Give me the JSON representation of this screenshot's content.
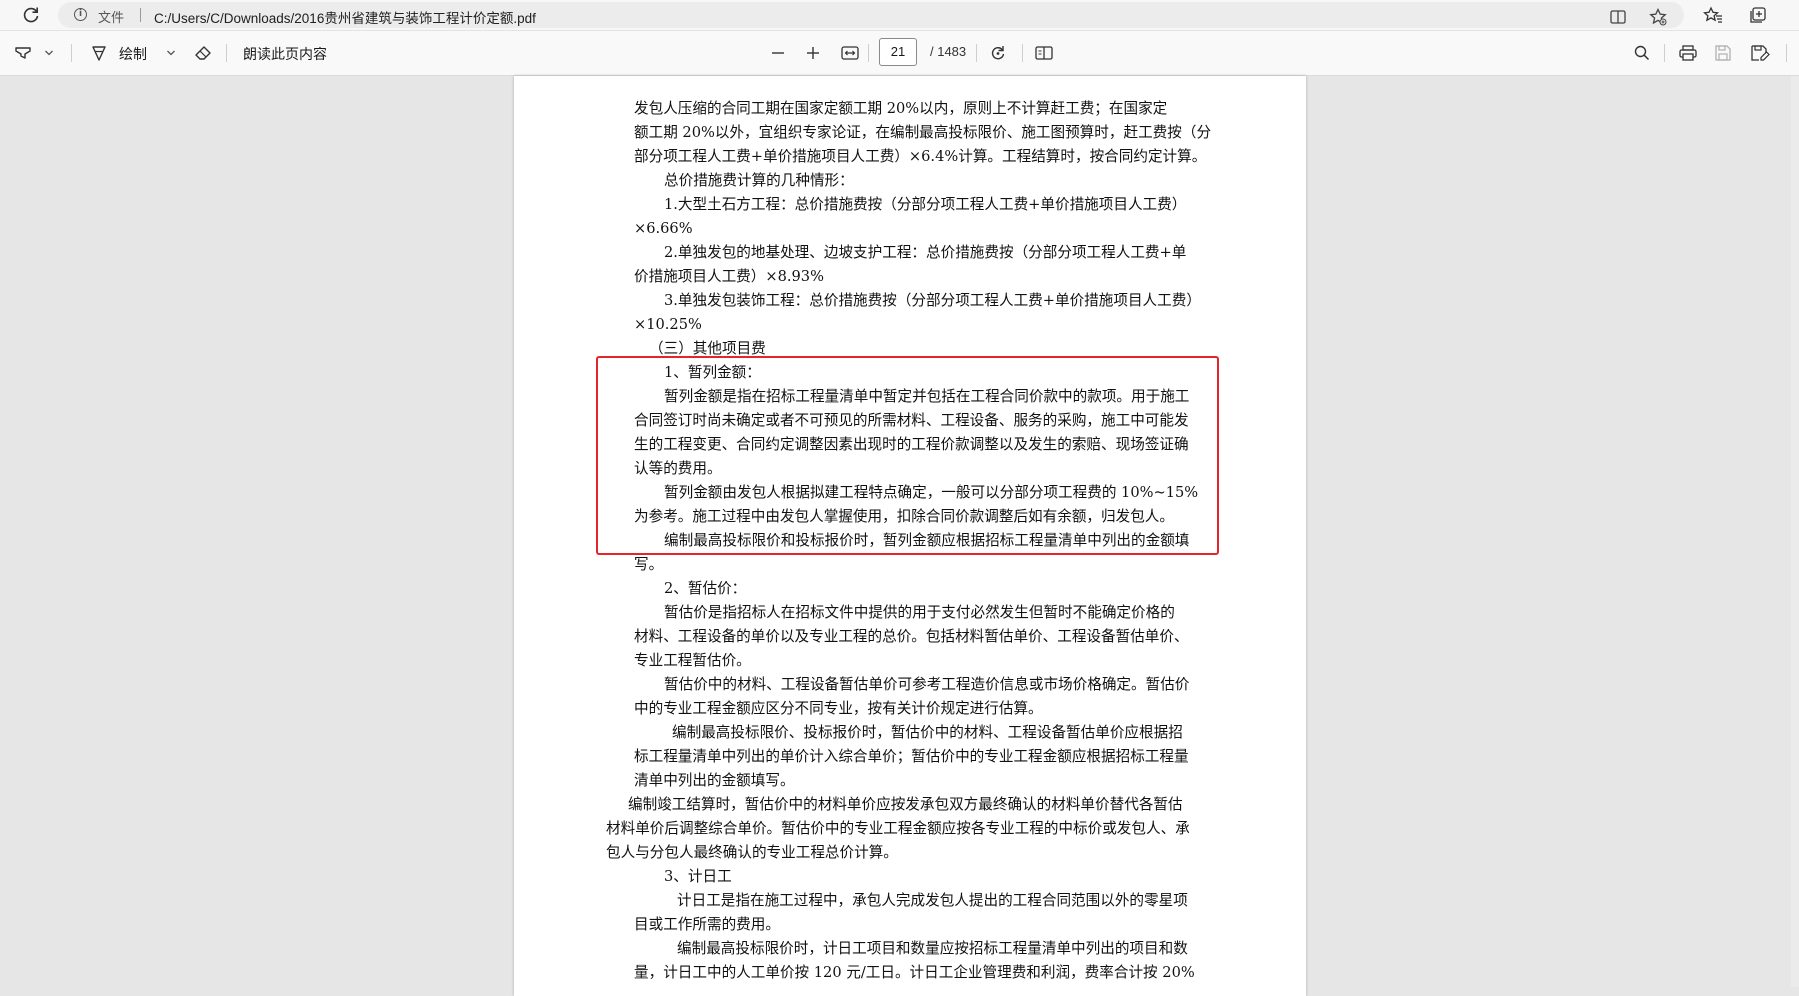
{
  "address_bar": {
    "file_label": "文件",
    "url": "C:/Users/C/Downloads/2016贵州省建筑与装饰工程计价定额.pdf"
  },
  "toolbar": {
    "draw_label": "绘制",
    "read_aloud_label": "朗读此页内容",
    "current_page": "21",
    "total_pages": "/ 1483"
  },
  "document": {
    "lines": [
      "发包人压缩的合同工期在国家定额工期 20%以内，原则上不计算赶工费；在国家定",
      "额工期 20%以外，宜组织专家论证，在编制最高投标限价、施工图预算时，赶工费按（分",
      "部分项工程人工费+单价措施项目人工费）×6.4%计算。工程结算时，按合同约定计算。",
      "总价措施费计算的几种情形：",
      "1.大型土石方工程：总价措施费按（分部分项工程人工费+单价措施项目人工费）",
      "×6.66%",
      "2.单独发包的地基处理、边坡支护工程：总价措施费按（分部分项工程人工费+单",
      "价措施项目人工费）×8.93%",
      "3.单独发包装饰工程：总价措施费按（分部分项工程人工费+单价措施项目人工费）",
      "×10.25%",
      "（三）其他项目费",
      "1、暂列金额：",
      "暂列金额是指在招标工程量清单中暂定并包括在工程合同价款中的款项。用于施工",
      "合同签订时尚未确定或者不可预见的所需材料、工程设备、服务的采购，施工中可能发",
      "生的工程变更、合同约定调整因素出现时的工程价款调整以及发生的索赔、现场签证确",
      "认等的费用。",
      "暂列金额由发包人根据拟建工程特点确定，一般可以分部分项工程费的 10%~15%",
      "为参考。施工过程中由发包人掌握使用，扣除合同价款调整后如有余额，归发包人。",
      "编制最高投标限价和投标报价时，暂列金额应根据招标工程量清单中列出的金额填",
      "写。",
      "2、暂估价：",
      "暂估价是指招标人在招标文件中提供的用于支付必然发生但暂时不能确定价格的",
      "材料、工程设备的单价以及专业工程的总价。包括材料暂估单价、工程设备暂估单价、",
      "专业工程暂估价。",
      "暂估价中的材料、工程设备暂估单价可参考工程造价信息或市场价格确定。暂估价",
      "中的专业工程金额应区分不同专业，按有关计价规定进行估算。",
      "编制最高投标限价、投标报价时，暂估价中的材料、工程设备暂估单价应根据招",
      "标工程量清单中列出的单价计入综合单价；暂估价中的专业工程金额应根据招标工程量",
      "清单中列出的金额填写。",
      "编制竣工结算时，暂估价中的材料单价应按发承包双方最终确认的材料单价替代各暂估",
      "材料单价后调整综合单价。暂估价中的专业工程金额应按各专业工程的中标价或发包人、承",
      "包人与分包人最终确认的专业工程总价计算。",
      "3、计日工",
      "计日工是指在施工过程中，承包人完成发包人提出的工程合同范围以外的零星项",
      "目或工作所需的费用。",
      "编制最高投标限价时，计日工项目和数量应按招标工程量清单中列出的项目和数",
      "量，计日工中的人工单价按 120 元/工日。计日工企业管理费和利润，费率合计按 20%"
    ]
  },
  "colors": {
    "highlight_box": "#e4262c",
    "page_background": "#ffffff",
    "canvas_background": "#e6e6e6"
  }
}
